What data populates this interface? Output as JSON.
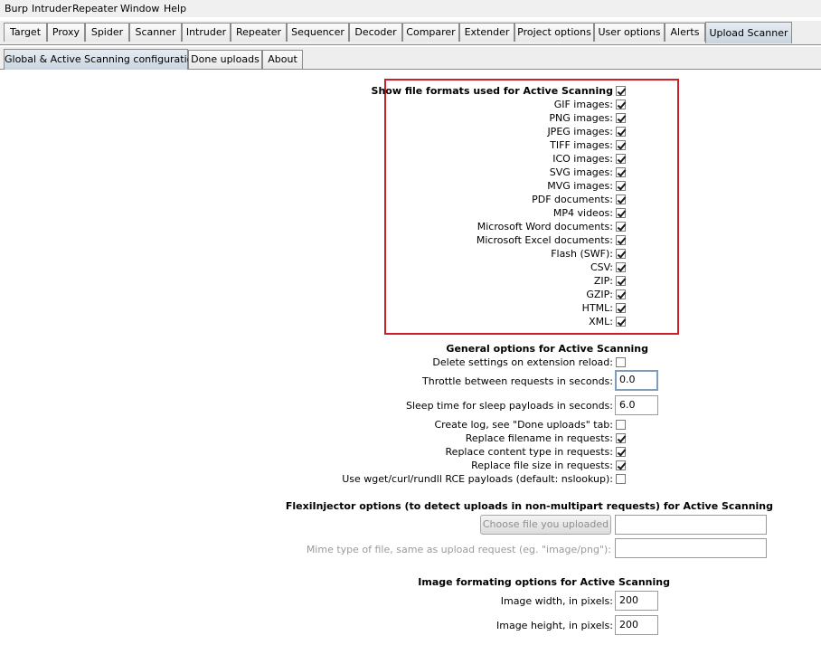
{
  "menubar": [
    "Burp",
    "Intruder",
    "Repeater",
    "Window",
    "Help"
  ],
  "main_tabs": [
    "Target",
    "Proxy",
    "Spider",
    "Scanner",
    "Intruder",
    "Repeater",
    "Sequencer",
    "Decoder",
    "Comparer",
    "Extender",
    "Project options",
    "User options",
    "Alerts",
    "Upload Scanner"
  ],
  "sub_tabs": [
    "Global & Active Scanning configuration",
    "Done uploads",
    "About"
  ],
  "file_formats": {
    "header": "Show file formats used for Active Scanning",
    "header_checked": true,
    "items": [
      {
        "label": "GIF images:",
        "checked": true
      },
      {
        "label": "PNG images:",
        "checked": true
      },
      {
        "label": "JPEG images:",
        "checked": true
      },
      {
        "label": "TIFF images:",
        "checked": true
      },
      {
        "label": "ICO images:",
        "checked": true
      },
      {
        "label": "SVG images:",
        "checked": true
      },
      {
        "label": "MVG images:",
        "checked": true
      },
      {
        "label": "PDF documents:",
        "checked": true
      },
      {
        "label": "MP4 videos:",
        "checked": true
      },
      {
        "label": "Microsoft Word documents:",
        "checked": true
      },
      {
        "label": "Microsoft Excel documents:",
        "checked": true
      },
      {
        "label": "Flash (SWF):",
        "checked": true
      },
      {
        "label": "CSV:",
        "checked": true
      },
      {
        "label": "ZIP:",
        "checked": true
      },
      {
        "label": "GZIP:",
        "checked": true
      },
      {
        "label": "HTML:",
        "checked": true
      },
      {
        "label": "XML:",
        "checked": true
      }
    ]
  },
  "general": {
    "header": "General options for Active Scanning",
    "delete_settings": {
      "label": "Delete settings on extension reload:",
      "checked": false
    },
    "throttle": {
      "label": "Throttle between requests in seconds:",
      "value": "0.0"
    },
    "sleep": {
      "label": "Sleep time for sleep payloads in seconds:",
      "value": "6.0"
    },
    "checks": [
      {
        "label": "Create log, see \"Done uploads\" tab:",
        "checked": false
      },
      {
        "label": "Replace filename in requests:",
        "checked": true
      },
      {
        "label": "Replace content type in requests:",
        "checked": true
      },
      {
        "label": "Replace file size in requests:",
        "checked": true
      },
      {
        "label": "Use wget/curl/rundll RCE payloads (default: nslookup):",
        "checked": false
      }
    ]
  },
  "flexi": {
    "header": "FlexiInjector options (to detect uploads in non-multipart requests) for Active Scanning",
    "choose_button": "Choose file you uploaded",
    "choose_value": "",
    "mime_label": "Mime type of file, same as upload request (eg. \"image/png\"):",
    "mime_value": ""
  },
  "image": {
    "header": "Image formating options for Active Scanning",
    "width": {
      "label": "Image width, in pixels:",
      "value": "200"
    },
    "height": {
      "label": "Image height, in pixels:",
      "value": "200"
    }
  }
}
